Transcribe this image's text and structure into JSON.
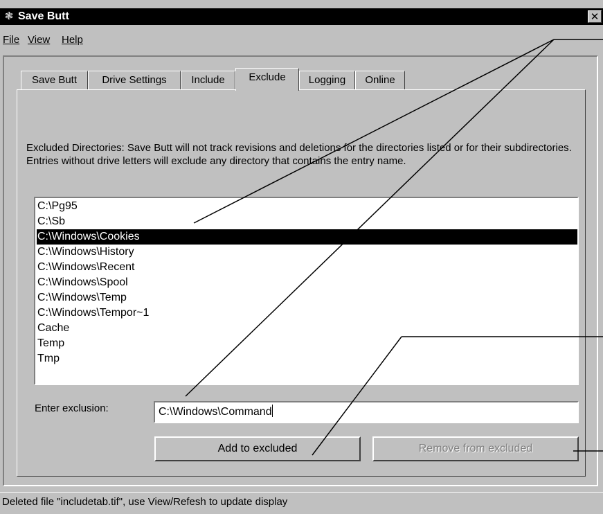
{
  "window": {
    "title": "Save Butt",
    "close_glyph": "✕"
  },
  "menu": [
    "File",
    "View",
    "Help"
  ],
  "tabs": [
    "Save Butt",
    "Drive Settings",
    "Include",
    "Exclude",
    "Logging",
    "Online"
  ],
  "active_tab": "Exclude",
  "exclude": {
    "description": "Excluded Directories:  Save Butt will not track revisions and deletions for the directories listed or for their subdirectories.  Entries without drive letters will exclude any directory that contains the entry name.",
    "items": [
      "C:\\Pg95",
      "C:\\Sb",
      "C:\\Windows\\Cookies",
      "C:\\Windows\\History",
      "C:\\Windows\\Recent",
      "C:\\Windows\\Spool",
      "C:\\Windows\\Temp",
      "C:\\Windows\\Tempor~1",
      "Cache",
      "Temp",
      "Tmp"
    ],
    "selected_item": "C:\\Windows\\Cookies",
    "entry_label": "Enter exclusion:",
    "entry_value": "C:\\Windows\\Command",
    "add_button": "Add to excluded",
    "remove_button": "Remove from excluded",
    "remove_enabled": false
  },
  "status": "Deleted file \"includetab.tif\",  use View/Refesh to update display"
}
